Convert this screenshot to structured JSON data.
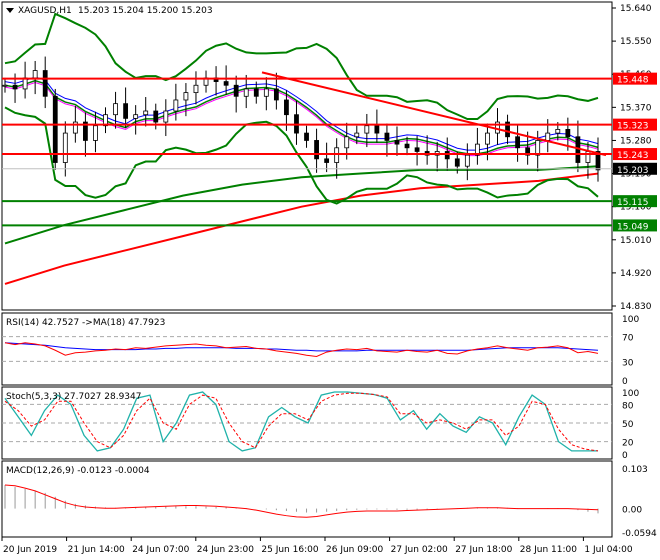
{
  "header": {
    "symbol": "XAGUSD,H1",
    "ohlc": "15.203 15.204 15.200 15.203"
  },
  "chart_data": [
    {
      "type": "candlestick",
      "title": "XAGUSD,H1",
      "ylim": [
        14.83,
        15.64
      ],
      "y_ticks": [
        "15.640",
        "15.550",
        "15.460",
        "15.370",
        "15.280",
        "15.190",
        "15.100",
        "15.010",
        "14.920",
        "14.830"
      ],
      "x_labels": [
        "20 Jun 2019",
        "21 Jun 14:00",
        "24 Jun 07:00",
        "24 Jun 23:00",
        "25 Jun 16:00",
        "26 Jun 09:00",
        "27 Jun 02:00",
        "27 Jun 18:00",
        "28 Jun 11:00",
        "1 Jul 04:00"
      ],
      "closes": [
        15.43,
        15.42,
        15.45,
        15.47,
        15.4,
        15.22,
        15.3,
        15.33,
        15.28,
        15.32,
        15.35,
        15.38,
        15.34,
        15.35,
        15.36,
        15.33,
        15.36,
        15.39,
        15.41,
        15.43,
        15.45,
        15.44,
        15.43,
        15.4,
        15.42,
        15.4,
        15.42,
        15.39,
        15.35,
        15.3,
        15.28,
        15.23,
        15.22,
        15.26,
        15.29,
        15.3,
        15.32,
        15.3,
        15.28,
        15.27,
        15.26,
        15.25,
        15.24,
        15.25,
        15.23,
        15.21,
        15.24,
        15.27,
        15.3,
        15.33,
        15.29,
        15.26,
        15.24,
        15.28,
        15.3,
        15.31,
        15.29,
        15.22,
        15.25,
        15.2
      ],
      "ma_long_green": [
        15.0,
        15.05,
        15.09,
        15.13,
        15.16,
        15.18,
        15.19,
        15.2,
        15.2,
        15.2,
        15.21
      ],
      "ma_long_red": [
        14.89,
        14.94,
        14.98,
        15.02,
        15.06,
        15.1,
        15.13,
        15.15,
        15.16,
        15.17,
        15.19
      ],
      "levels": [
        {
          "label": "15.448",
          "value": 15.448,
          "color": "#ff0000"
        },
        {
          "label": "15.323",
          "value": 15.323,
          "color": "#ff0000"
        },
        {
          "label": "15.243",
          "value": 15.243,
          "color": "#ff0000"
        },
        {
          "label": "15.203",
          "value": 15.203,
          "color": "#000000"
        },
        {
          "label": "15.115",
          "value": 15.115,
          "color": "#008000"
        },
        {
          "label": "15.049",
          "value": 15.049,
          "color": "#008000"
        }
      ],
      "trendline": [
        15.465,
        15.24
      ]
    },
    {
      "type": "line",
      "title": "RSI(14) 42.7527  ->MA(18) 47.7923",
      "ylim": [
        0,
        100
      ],
      "y_ticks": [
        "100",
        "70",
        "30",
        "0"
      ],
      "rsi": [
        60,
        57,
        60,
        58,
        55,
        48,
        40,
        44,
        45,
        47,
        48,
        50,
        49,
        52,
        51,
        53,
        55,
        56,
        57,
        58,
        56,
        55,
        52,
        53,
        54,
        51,
        50,
        47,
        45,
        43,
        40,
        38,
        45,
        48,
        50,
        49,
        51,
        47,
        46,
        45,
        48,
        46,
        45,
        48,
        43,
        42,
        47,
        50,
        52,
        55,
        52,
        50,
        48,
        52,
        53,
        55,
        52,
        44,
        46,
        43
      ],
      "ma": [
        60,
        59,
        58,
        57,
        56,
        54,
        52,
        51,
        50,
        49,
        49,
        49,
        49,
        49,
        50,
        50,
        51,
        51,
        52,
        52,
        52,
        52,
        52,
        51,
        51,
        51,
        50,
        50,
        49,
        48,
        48,
        47,
        47,
        47,
        47,
        47,
        48,
        48,
        48,
        48,
        48,
        48,
        48,
        48,
        48,
        48,
        48,
        49,
        50,
        51,
        52,
        52,
        52,
        52,
        52,
        52,
        51,
        50,
        49,
        48
      ]
    },
    {
      "type": "line",
      "title": "Stoch(5,3,3) 27.7027 28.9347",
      "ylim": [
        0,
        100
      ],
      "y_ticks": [
        "100",
        "80",
        "50",
        "20",
        "0"
      ],
      "k": [
        90,
        60,
        30,
        70,
        95,
        80,
        30,
        5,
        10,
        40,
        90,
        95,
        20,
        50,
        95,
        100,
        80,
        20,
        5,
        10,
        60,
        75,
        60,
        50,
        95,
        100,
        100,
        98,
        96,
        90,
        55,
        70,
        40,
        65,
        45,
        35,
        60,
        50,
        15,
        60,
        95,
        80,
        20,
        5,
        5,
        5
      ],
      "d": [
        85,
        70,
        45,
        55,
        85,
        85,
        50,
        20,
        10,
        30,
        70,
        90,
        50,
        40,
        80,
        95,
        90,
        50,
        20,
        10,
        45,
        65,
        65,
        55,
        85,
        95,
        98,
        98,
        96,
        92,
        65,
        65,
        50,
        55,
        50,
        40,
        55,
        55,
        30,
        45,
        85,
        80,
        40,
        15,
        8,
        5
      ]
    },
    {
      "type": "bar",
      "title": "MACD(12,26,9) -0.0123 -0.0004",
      "ylim": [
        -0.0594,
        0.103
      ],
      "y_ticks": [
        "0.103",
        "0.00",
        "-0.0594"
      ],
      "hist": [
        0.06,
        0.055,
        0.05,
        0.045,
        0.04,
        0.03,
        0.02,
        0.012,
        0.008,
        0.005,
        0.003,
        0.002,
        0.002,
        0.003,
        0.004,
        0.005,
        0.005,
        0.006,
        0.006,
        0.006,
        0.005,
        0.004,
        0.003,
        0.002,
        0.001,
        0,
        -0.002,
        -0.004,
        -0.006,
        -0.008,
        -0.01,
        -0.01,
        -0.008,
        -0.006,
        -0.004,
        -0.003,
        -0.002,
        -0.002,
        -0.002,
        -0.003,
        -0.003,
        -0.003,
        -0.002,
        -0.001,
        0,
        0.001,
        0.002,
        0.003,
        0.003,
        0.003,
        0.002,
        0.001,
        0,
        0,
        0.001,
        0.001,
        0,
        -0.004,
        -0.008,
        -0.012
      ],
      "signal": [
        0.06,
        0.058,
        0.052,
        0.045,
        0.035,
        0.025,
        0.015,
        0.008,
        0.004,
        0.002,
        0.001,
        0.001,
        0.002,
        0.003,
        0.004,
        0.005,
        0.006,
        0.007,
        0.008,
        0.008,
        0.007,
        0.006,
        0.004,
        0.002,
        0,
        -0.004,
        -0.009,
        -0.014,
        -0.018,
        -0.021,
        -0.022,
        -0.02,
        -0.016,
        -0.012,
        -0.009,
        -0.007,
        -0.006,
        -0.006,
        -0.006,
        -0.006,
        -0.005,
        -0.004,
        -0.003,
        -0.002,
        -0.001,
        0,
        0.001,
        0.002,
        0.002,
        0.002,
        0.001,
        0,
        0,
        0,
        0,
        0,
        0,
        -0.001,
        -0.002,
        -0.003
      ]
    }
  ]
}
